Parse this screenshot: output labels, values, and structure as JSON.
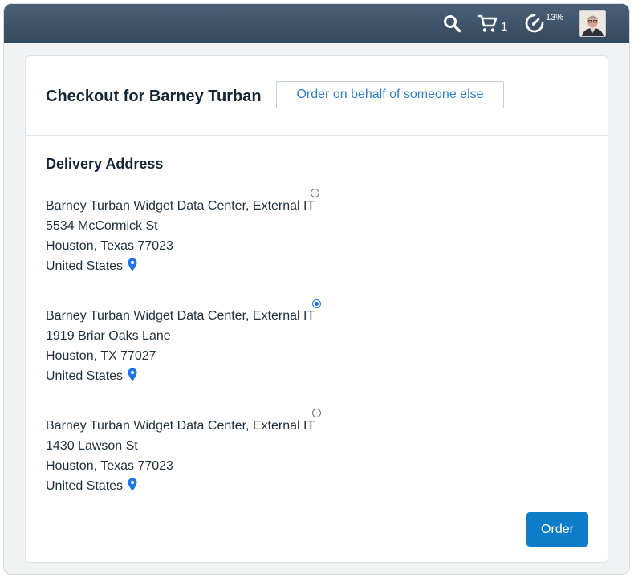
{
  "topbar": {
    "cart_count": "1",
    "progress_percent": "13%",
    "icons": [
      "search-icon",
      "cart-icon",
      "progress-gauge-icon",
      "user-avatar"
    ]
  },
  "checkout": {
    "title": "Checkout for Barney Turban",
    "behalf_button_label": "Order on behalf of someone else"
  },
  "delivery": {
    "section_title": "Delivery Address",
    "addresses": [
      {
        "name": "Barney Turban Widget Data Center, External IT",
        "street": "5534 McCormick St",
        "city": "Houston, Texas 77023",
        "country": "United States",
        "selected": false
      },
      {
        "name": "Barney Turban Widget Data Center, External IT",
        "street": "1919 Briar Oaks Lane",
        "city": "Houston, TX 77027",
        "country": "United States",
        "selected": true
      },
      {
        "name": "Barney Turban Widget Data Center, External IT",
        "street": "1430 Lawson St",
        "city": "Houston, Texas 77023",
        "country": "United States",
        "selected": false
      }
    ]
  },
  "actions": {
    "order_label": "Order"
  },
  "colors": {
    "topbar": "#3f5469",
    "accent": "#0e7dc9",
    "link": "#2f7fd1",
    "pin": "#1a73e8"
  }
}
